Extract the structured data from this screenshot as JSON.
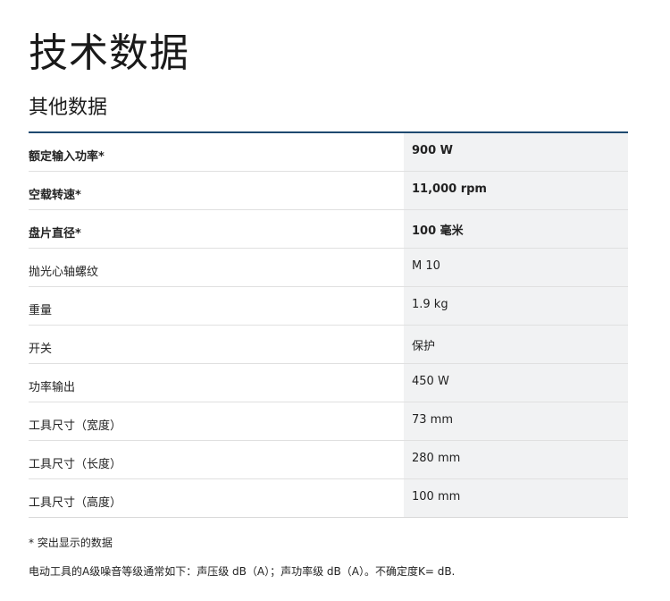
{
  "page": {
    "title": "技术数据",
    "section_title": "其他数据"
  },
  "specs": [
    {
      "label": "额定输入功率*",
      "value": "900 W",
      "highlight": true
    },
    {
      "label": "空载转速*",
      "value": "11,000 rpm",
      "highlight": true
    },
    {
      "label": "盘片直径*",
      "value": "100 毫米",
      "highlight": true
    },
    {
      "label": "抛光心轴螺纹",
      "value": "M 10",
      "highlight": false
    },
    {
      "label": "重量",
      "value": "1.9 kg",
      "highlight": false
    },
    {
      "label": "开关",
      "value": "保护",
      "highlight": false
    },
    {
      "label": "功率输出",
      "value": "450 W",
      "highlight": false
    },
    {
      "label": "工具尺寸（宽度）",
      "value": "73 mm",
      "highlight": false
    },
    {
      "label": "工具尺寸（长度）",
      "value": "280 mm",
      "highlight": false
    },
    {
      "label": "工具尺寸（高度）",
      "value": "100 mm",
      "highlight": false
    }
  ],
  "footnote": "* 突出显示的数据",
  "note": "电动工具的A级噪音等级通常如下：声压级 dB（A）；声功率级 dB（A）。不确定度K= dB.",
  "colors": {
    "table_top_border": "#1e4a70",
    "value_background": "#f1f2f3"
  }
}
